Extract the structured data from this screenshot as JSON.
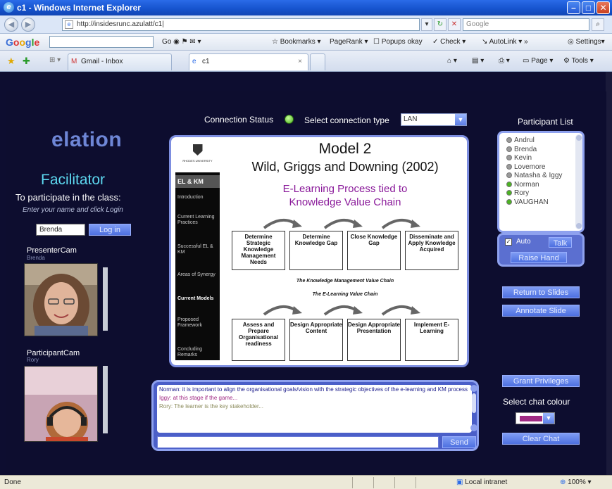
{
  "browser": {
    "window_title": "c1 - Windows Internet Explorer",
    "url": "http://insidesrunc.azulatt/c1|",
    "search_placeholder": "Google",
    "tabs": [
      {
        "label": "Gmail - Inbox"
      },
      {
        "label": "c1"
      }
    ],
    "toolbar_items": [
      "Bookmarks",
      "PageRank",
      "Popups okay",
      "Check",
      "AutoLink",
      "Settings"
    ],
    "tab_commands": [
      "Page",
      "Tools"
    ],
    "status_text": "Done",
    "zone": "Local intranet",
    "zoom": "100%"
  },
  "app": {
    "logo": "elation",
    "role": "Facilitator",
    "participate_heading": "To participate in the class:",
    "participate_hint": "Enter your name and click Login",
    "name_value": "Brenda",
    "login_label": "Log in",
    "presenter_cam_label": "PresenterCam",
    "presenter_cam_name": "Brenda",
    "participant_cam_label": "ParticipantCam",
    "participant_cam_name": "Rory",
    "connection_status_label": "Connection Status",
    "connection_status_color": "#4bb321",
    "select_connection_label": "Select connection type",
    "connection_type": "LAN"
  },
  "slide": {
    "university": "RHODES UNIVERSITY",
    "nav_header": "EL & KM",
    "nav_items": [
      {
        "label": "Introduction",
        "bold": false
      },
      {
        "label": "Current Learning Practices",
        "bold": false
      },
      {
        "label": "Successful EL & KM",
        "bold": false
      },
      {
        "label": "Areas of Synergy",
        "bold": false
      },
      {
        "label": "Current Models",
        "bold": true
      },
      {
        "label": "Proposed Framework",
        "bold": false
      },
      {
        "label": "Concluding Remarks",
        "bold": false
      }
    ],
    "title": "Model 2",
    "authors": "Wild, Griggs and Downing (2002)",
    "subtitle_line1": "E-Learning Process tied to",
    "subtitle_line2": "Knowledge Value Chain",
    "km_boxes": [
      "Determine Strategic Knowledge Management Needs",
      "Determine Knowledge Gap",
      "Close Knowledge Gap",
      "Disseminate and Apply Knowledge Acquired"
    ],
    "km_chain_label": "The Knowledge Management Value Chain",
    "el_chain_label": "The E-Learning Value Chain",
    "el_boxes": [
      "Assess and Prepare Organisational readiness",
      "Design Appropriate Content",
      "Design Appropriate Presentation",
      "Implement E-Learning"
    ]
  },
  "participants": {
    "title": "Participant List",
    "list": [
      {
        "name": "Andrul",
        "status": "grey"
      },
      {
        "name": "Brenda",
        "status": "grey"
      },
      {
        "name": "Kevin",
        "status": "grey"
      },
      {
        "name": "Lovemore",
        "status": "grey"
      },
      {
        "name": "Natasha & Iggy",
        "status": "grey"
      },
      {
        "name": "Norman",
        "status": "green"
      },
      {
        "name": "Rory",
        "status": "green"
      },
      {
        "name": "VAUGHAN",
        "status": "green"
      }
    ],
    "auto_label": "Auto",
    "auto_checked": true,
    "talk_label": "Talk",
    "raise_hand_label": "Raise Hand"
  },
  "controls": {
    "return_label": "Return to Slides",
    "annotate_label": "Annotate Slide",
    "grant_label": "Grant Privileges",
    "chat_colour_label": "Select chat colour",
    "chat_colour": "#a02a84",
    "clear_chat_label": "Clear Chat"
  },
  "chat": {
    "messages": [
      {
        "text": "Norman: it is important to align the organisational goals/vision with the strategic objectives of the e-learning and KM process",
        "color": "#1a1a8a"
      },
      {
        "text": "Iggy: at this stage if the game...",
        "color": "#a02a84"
      },
      {
        "text": "Rory: The learner is the key stakeholder...",
        "color": "#8a8a5a"
      }
    ],
    "send_label": "Send"
  },
  "colors": {
    "accent": "#5dd8f0",
    "panel": "#4b5fc8",
    "online": "#4bb321"
  }
}
